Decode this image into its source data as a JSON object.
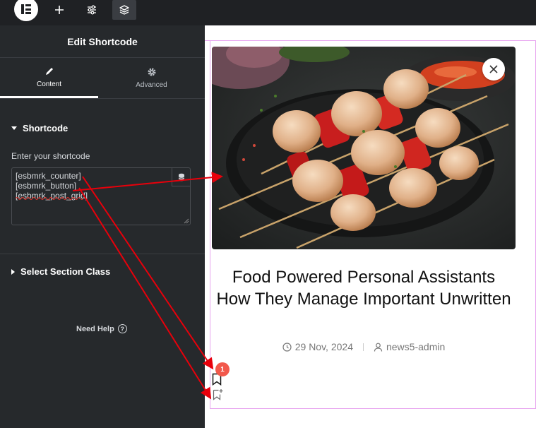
{
  "panel": {
    "title": "Edit Shortcode",
    "tabs": [
      {
        "label": "Content",
        "icon": "pencil-icon"
      },
      {
        "label": "Advanced",
        "icon": "gear-icon"
      }
    ],
    "shortcode_section": "Shortcode",
    "field_label": "Enter your shortcode",
    "shortcode_value": "[esbmrk_counter]\n[esbmrk_button]\n[esbmrk_post_grid]",
    "select_section_class": "Select Section Class",
    "need_help": "Need Help"
  },
  "post": {
    "title": "Food Powered Personal Assistants How They Manage Important Unwritten",
    "date": "29 Nov, 2024",
    "author": "news5-admin",
    "badge_count": "1"
  },
  "colors": {
    "topbar": "#1f2124",
    "panel": "#26292c",
    "selection_outline": "#e7a4ef",
    "annotation_arrow": "#e8000b",
    "badge": "#f2584b"
  }
}
